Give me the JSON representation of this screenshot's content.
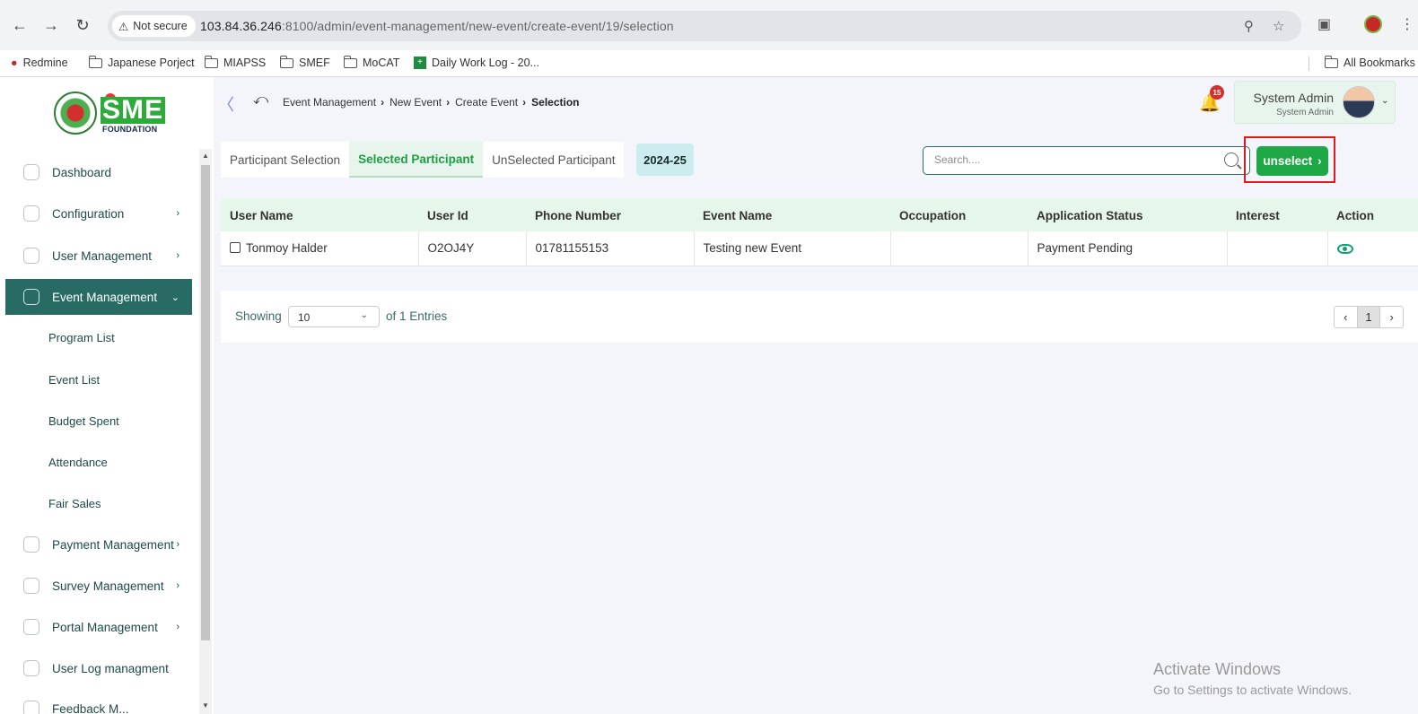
{
  "browser": {
    "security_label": "Not secure",
    "url_host": "103.84.36.246",
    "url_rest": ":8100/admin/event-management/new-event/create-event/19/selection",
    "bookmarks": [
      "Redmine",
      "Japanese Porject",
      "MIAPSS",
      "SMEF",
      "MoCAT",
      "Daily Work Log - 20...",
      "All Bookmarks"
    ]
  },
  "brand": {
    "logo_text": "SME",
    "logo_sub": "FOUNDATION",
    "accent_color": "#286b64",
    "green_color": "#1fa846"
  },
  "header": {
    "breadcrumb": [
      "Event Management",
      "New Event",
      "Create Event",
      "Selection"
    ],
    "notification_count": "15",
    "user_name": "System Admin",
    "user_role": "System Admin"
  },
  "sidebar": {
    "items": [
      {
        "label": "Dashboard",
        "icon": "grid-icon"
      },
      {
        "label": "Configuration",
        "icon": "config-icon"
      },
      {
        "label": "User Management",
        "icon": "shield-user-icon"
      },
      {
        "label": "Event Management",
        "icon": "event-icon"
      },
      {
        "label": "Payment Management",
        "icon": "payment-icon"
      },
      {
        "label": "Survey Management",
        "icon": "pie-icon"
      },
      {
        "label": "Portal Management",
        "icon": "portal-icon"
      },
      {
        "label": "User Log managment",
        "icon": "log-icon"
      },
      {
        "label": "Feedback M...",
        "icon": "feedback-icon"
      }
    ],
    "sub_items": [
      "Program List",
      "Event List",
      "Budget Spent",
      "Attendance",
      "Fair Sales"
    ]
  },
  "tabs": [
    "Participant Selection",
    "Selected Participant",
    "UnSelected Participant"
  ],
  "year": "2024-25",
  "search": {
    "placeholder": "Search...."
  },
  "unselect_label": "unselect",
  "table": {
    "columns": [
      "User Name",
      "User Id",
      "Phone Number",
      "Event Name",
      "Occupation",
      "Application Status",
      "Interest",
      "Action"
    ],
    "rows": [
      {
        "user_name": "Tonmoy Halder",
        "user_id": "O2OJ4Y",
        "phone": "01781155153",
        "event_name": "Testing new Event",
        "occupation": "",
        "status": "Payment Pending",
        "interest": ""
      }
    ]
  },
  "pagination": {
    "showing_label": "Showing",
    "page_size": "10",
    "entries_label": "of 1 Entries",
    "current_page": "1"
  },
  "watermark": {
    "line1": "Activate Windows",
    "line2": "Go to Settings to activate Windows."
  }
}
